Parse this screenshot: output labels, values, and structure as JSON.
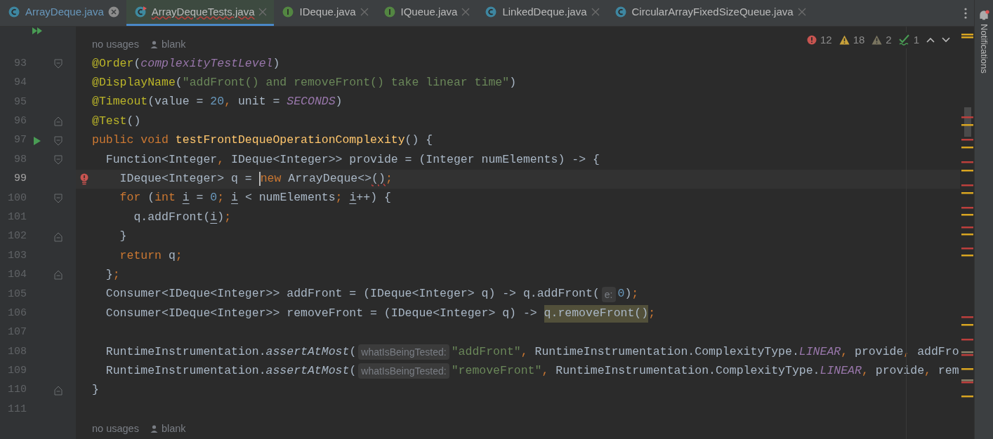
{
  "tabs": [
    {
      "label": "ArrayDeque.java",
      "kind": "class",
      "selected": false,
      "modified": true,
      "has_errors": false,
      "hovered": true
    },
    {
      "label": "ArrayDequeTests.java",
      "kind": "test-class",
      "selected": true,
      "modified": false,
      "has_errors": true,
      "hovered": false
    },
    {
      "label": "IDeque.java",
      "kind": "interface",
      "selected": false,
      "modified": false,
      "has_errors": false,
      "hovered": false
    },
    {
      "label": "IQueue.java",
      "kind": "interface",
      "selected": false,
      "modified": false,
      "has_errors": false,
      "hovered": false
    },
    {
      "label": "LinkedDeque.java",
      "kind": "class",
      "selected": false,
      "modified": false,
      "has_errors": false,
      "hovered": false
    },
    {
      "label": "CircularArrayFixedSizeQueue.java",
      "kind": "class",
      "selected": false,
      "modified": false,
      "has_errors": false,
      "hovered": false
    }
  ],
  "inspections": [
    {
      "kind": "error",
      "count": "12"
    },
    {
      "kind": "warning",
      "count": "18"
    },
    {
      "kind": "weak",
      "count": "2"
    },
    {
      "kind": "typo",
      "count": "1"
    }
  ],
  "side_panel": {
    "label": "Notifications",
    "has_new": true
  },
  "lines": [
    {
      "kind": "clipped",
      "gutter_marker": {
        "kind": "run-all"
      }
    },
    {
      "kind": "inlay",
      "usages": "no usages",
      "author": "blank"
    },
    {
      "kind": "code",
      "number": "93",
      "current": false,
      "fold_marker": {
        "kind": "open"
      },
      "tokens": [
        {
          "kind": "ann",
          "text": "@Order"
        },
        {
          "kind": "plain",
          "text": "("
        },
        {
          "kind": "const",
          "text": "complexityTestLevel"
        },
        {
          "kind": "plain",
          "text": ")"
        }
      ]
    },
    {
      "kind": "code",
      "number": "94",
      "current": false,
      "tokens": [
        {
          "kind": "ann",
          "text": "@DisplayName"
        },
        {
          "kind": "plain",
          "text": "("
        },
        {
          "kind": "str",
          "text": "\"addFront() and removeFront() take linear time\""
        },
        {
          "kind": "plain",
          "text": ")"
        }
      ]
    },
    {
      "kind": "code",
      "number": "95",
      "current": false,
      "tokens": [
        {
          "kind": "ann",
          "text": "@Timeout"
        },
        {
          "kind": "plain",
          "text": "(value = "
        },
        {
          "kind": "num",
          "text": "20"
        },
        {
          "kind": "punct",
          "text": ", "
        },
        {
          "kind": "plain",
          "text": "unit = "
        },
        {
          "kind": "const",
          "text": "SECONDS"
        },
        {
          "kind": "plain",
          "text": ")"
        }
      ]
    },
    {
      "kind": "code",
      "number": "96",
      "current": false,
      "fold_marker": {
        "kind": "close"
      },
      "tokens": [
        {
          "kind": "ann",
          "text": "@Test"
        },
        {
          "kind": "plain",
          "text": "()"
        }
      ]
    },
    {
      "kind": "code",
      "number": "97",
      "current": false,
      "gutter_marker": {
        "kind": "run"
      },
      "fold_marker": {
        "kind": "open"
      },
      "tokens": [
        {
          "kind": "kw",
          "text": "public void "
        },
        {
          "kind": "method",
          "text": "testFrontDequeOperationComplexity"
        },
        {
          "kind": "plain",
          "text": "() {"
        }
      ]
    },
    {
      "kind": "code",
      "number": "98",
      "current": false,
      "fold_marker": {
        "kind": "open"
      },
      "tokens": [
        {
          "kind": "plain",
          "text": "  Function<Integer"
        },
        {
          "kind": "punct",
          "text": ", "
        },
        {
          "kind": "plain",
          "text": "IDeque<Integer>> provide = (Integer numElements) -> {"
        }
      ]
    },
    {
      "kind": "code",
      "number": "99",
      "current": true,
      "gutter_marker": {
        "kind": "error-bulb"
      },
      "tokens": [
        {
          "kind": "plain",
          "text": "    IDeque<Integer> q = "
        },
        {
          "kind": "caret"
        },
        {
          "kind": "kw",
          "text": "new "
        },
        {
          "kind": "plain",
          "text": "ArrayDeque<>"
        },
        {
          "kind": "err",
          "text": "()"
        },
        {
          "kind": "punct",
          "text": ";"
        }
      ]
    },
    {
      "kind": "code",
      "number": "100",
      "current": false,
      "fold_marker": {
        "kind": "open"
      },
      "tokens": [
        {
          "kind": "kw",
          "text": "    for "
        },
        {
          "kind": "plain",
          "text": "("
        },
        {
          "kind": "kw",
          "text": "int "
        },
        {
          "kind": "var",
          "text": "i"
        },
        {
          "kind": "plain",
          "text": " = "
        },
        {
          "kind": "num",
          "text": "0"
        },
        {
          "kind": "punct",
          "text": "; "
        },
        {
          "kind": "var",
          "text": "i"
        },
        {
          "kind": "plain",
          "text": " < numElements"
        },
        {
          "kind": "punct",
          "text": "; "
        },
        {
          "kind": "var",
          "text": "i"
        },
        {
          "kind": "plain",
          "text": "++) {"
        }
      ]
    },
    {
      "kind": "code",
      "number": "101",
      "current": false,
      "tokens": [
        {
          "kind": "plain",
          "text": "      q.addFront("
        },
        {
          "kind": "var",
          "text": "i"
        },
        {
          "kind": "plain",
          "text": ")"
        },
        {
          "kind": "punct",
          "text": ";"
        }
      ]
    },
    {
      "kind": "code",
      "number": "102",
      "current": false,
      "fold_marker": {
        "kind": "close"
      },
      "tokens": [
        {
          "kind": "plain",
          "text": "    }"
        }
      ]
    },
    {
      "kind": "code",
      "number": "103",
      "current": false,
      "tokens": [
        {
          "kind": "kw",
          "text": "    return "
        },
        {
          "kind": "plain",
          "text": "q"
        },
        {
          "kind": "punct",
          "text": ";"
        }
      ]
    },
    {
      "kind": "code",
      "number": "104",
      "current": false,
      "fold_marker": {
        "kind": "close"
      },
      "tokens": [
        {
          "kind": "plain",
          "text": "  }"
        },
        {
          "kind": "punct",
          "text": ";"
        }
      ]
    },
    {
      "kind": "code",
      "number": "105",
      "current": false,
      "tokens": [
        {
          "kind": "plain",
          "text": "  Consumer<IDeque<Integer>> addFront = (IDeque<Integer> q) -> q.addFront("
        },
        {
          "kind": "hint",
          "text": "e:"
        },
        {
          "kind": "num",
          "text": "0"
        },
        {
          "kind": "plain",
          "text": ")"
        },
        {
          "kind": "punct",
          "text": ";"
        }
      ]
    },
    {
      "kind": "code",
      "number": "106",
      "current": false,
      "tokens": [
        {
          "kind": "plain",
          "text": "  Consumer<IDeque<Integer>> removeFront = (IDeque<Integer> q) -> "
        },
        {
          "kind": "match",
          "text": "q.removeFront()"
        },
        {
          "kind": "punct",
          "text": ";"
        }
      ]
    },
    {
      "kind": "code",
      "number": "107",
      "current": false
    },
    {
      "kind": "code",
      "number": "108",
      "current": false,
      "tokens": [
        {
          "kind": "plain",
          "text": "  RuntimeInstrumentation."
        },
        {
          "kind": "static",
          "text": "assertAtMost"
        },
        {
          "kind": "plain",
          "text": "("
        },
        {
          "kind": "hint",
          "text": "whatIsBeingTested:"
        },
        {
          "kind": "str",
          "text": "\"addFront\""
        },
        {
          "kind": "punct",
          "text": ", "
        },
        {
          "kind": "plain",
          "text": "RuntimeInstrumentation.ComplexityType."
        },
        {
          "kind": "const",
          "text": "LINEAR"
        },
        {
          "kind": "punct",
          "text": ", "
        },
        {
          "kind": "plain",
          "text": "provide"
        },
        {
          "kind": "punct",
          "text": ", "
        },
        {
          "kind": "plain",
          "text": "addFro"
        }
      ]
    },
    {
      "kind": "code",
      "number": "109",
      "current": false,
      "tokens": [
        {
          "kind": "plain",
          "text": "  RuntimeInstrumentation."
        },
        {
          "kind": "static",
          "text": "assertAtMost"
        },
        {
          "kind": "plain",
          "text": "("
        },
        {
          "kind": "hint",
          "text": "whatIsBeingTested:"
        },
        {
          "kind": "str",
          "text": "\"removeFront\""
        },
        {
          "kind": "punct",
          "text": ", "
        },
        {
          "kind": "plain",
          "text": "RuntimeInstrumentation.ComplexityType."
        },
        {
          "kind": "const",
          "text": "LINEAR"
        },
        {
          "kind": "punct",
          "text": ", "
        },
        {
          "kind": "plain",
          "text": "provide"
        },
        {
          "kind": "punct",
          "text": ", "
        },
        {
          "kind": "plain",
          "text": "rem"
        }
      ]
    },
    {
      "kind": "code",
      "number": "110",
      "current": false,
      "fold_marker": {
        "kind": "close"
      },
      "tokens": [
        {
          "kind": "plain",
          "text": "}"
        }
      ]
    },
    {
      "kind": "code",
      "number": "111",
      "current": false
    },
    {
      "kind": "inlay",
      "usages": "no usages",
      "author": "blank"
    }
  ]
}
